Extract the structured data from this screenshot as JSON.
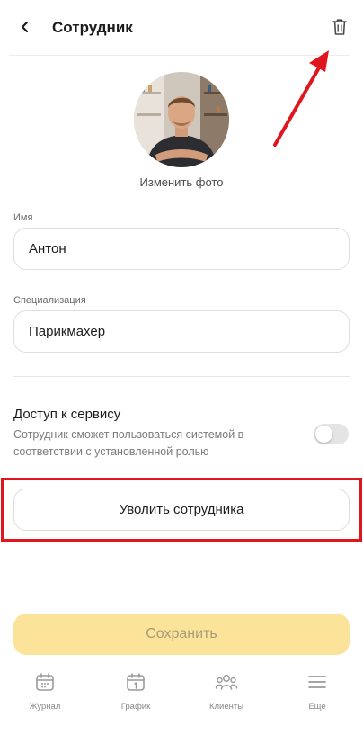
{
  "header": {
    "back_icon": "chevron-left-icon",
    "title": "Сотрудник",
    "delete_icon": "trash-icon"
  },
  "profile": {
    "change_photo": "Изменить фото"
  },
  "form": {
    "name_label": "Имя",
    "name_value": "Антон",
    "spec_label": "Специализация",
    "spec_value": "Парикмахер"
  },
  "access": {
    "title": "Доступ к сервису",
    "description": "Сотрудник сможет пользоваться системой в соответствии с установленной ролью",
    "enabled": false
  },
  "actions": {
    "fire_label": "Уволить сотрудника",
    "save_label": "Сохранить"
  },
  "annotation": {
    "highlight_color": "#e0161e"
  },
  "colors": {
    "save_button": "#fbe49a",
    "save_text": "#a59a7a"
  },
  "tabbar": {
    "items": [
      {
        "label": "Журнал",
        "icon": "calendar-dots-icon"
      },
      {
        "label": "График",
        "icon": "calendar-one-icon"
      },
      {
        "label": "Клиенты",
        "icon": "people-icon"
      },
      {
        "label": "Еще",
        "icon": "menu-icon"
      }
    ]
  }
}
